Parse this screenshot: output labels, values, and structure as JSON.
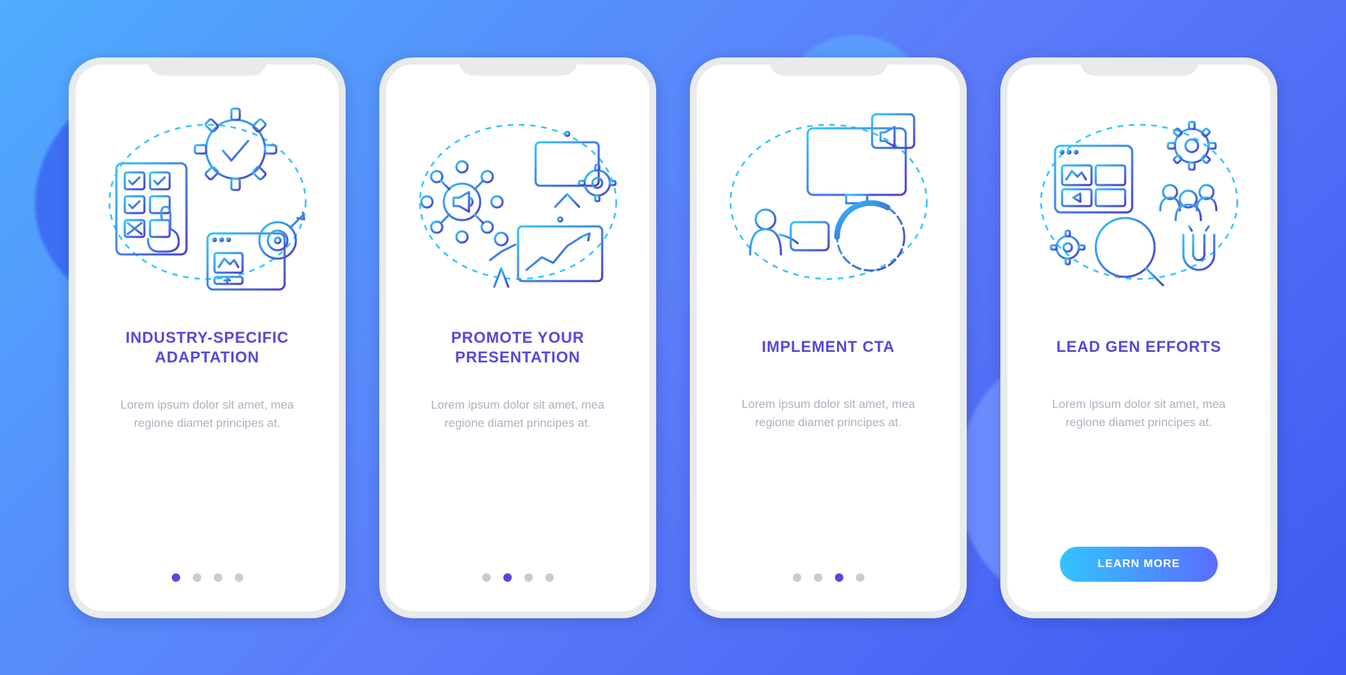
{
  "screens": [
    {
      "title": "INDUSTRY-SPECIFIC\nADAPTATION",
      "body": "Lorem ipsum dolor sit amet, mea regione diamet principes at.",
      "illustration": "industry-adaptation",
      "active_dot_index": 0,
      "has_cta": false
    },
    {
      "title": "PROMOTE YOUR\nPRESENTATION",
      "body": "Lorem ipsum dolor sit amet, mea regione diamet principes at.",
      "illustration": "promote-presentation",
      "active_dot_index": 1,
      "has_cta": false
    },
    {
      "title": "IMPLEMENT CTA",
      "body": "Lorem ipsum dolor sit amet, mea regione diamet principes at.",
      "illustration": "implement-cta",
      "active_dot_index": 2,
      "has_cta": false
    },
    {
      "title": "LEAD GEN EFFORTS",
      "body": "Lorem ipsum dolor sit amet, mea regione diamet principes at.",
      "illustration": "lead-gen",
      "active_dot_index": 3,
      "has_cta": true,
      "cta_label": "LEARN MORE"
    }
  ],
  "dot_count": 4
}
